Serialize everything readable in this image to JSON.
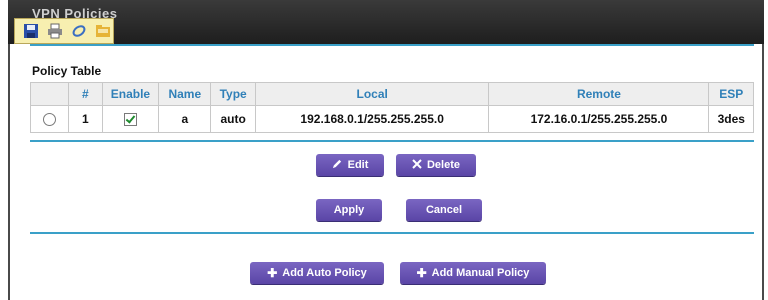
{
  "window": {
    "title": "VPN Policies"
  },
  "toolbar": {
    "icons": [
      "save-icon",
      "print-icon",
      "attach-icon",
      "folder-icon"
    ]
  },
  "policy_table": {
    "title": "Policy Table",
    "columns": [
      "",
      "#",
      "Enable",
      "Name",
      "Type",
      "Local",
      "Remote",
      "ESP"
    ],
    "rows": [
      {
        "index": "1",
        "enabled": true,
        "name": "a",
        "type": "auto",
        "local": "192.168.0.1/255.255.255.0",
        "remote": "172.16.0.1/255.255.255.0",
        "esp": "3des"
      }
    ]
  },
  "actions": {
    "edit_label": "Edit",
    "delete_label": "Delete",
    "apply_label": "Apply",
    "cancel_label": "Cancel",
    "add_auto_label": "Add Auto Policy",
    "add_manual_label": "Add Manual Policy"
  },
  "colors": {
    "accent": "#3aa0c8",
    "button": "#6652b4",
    "header_text": "#3080b8"
  }
}
